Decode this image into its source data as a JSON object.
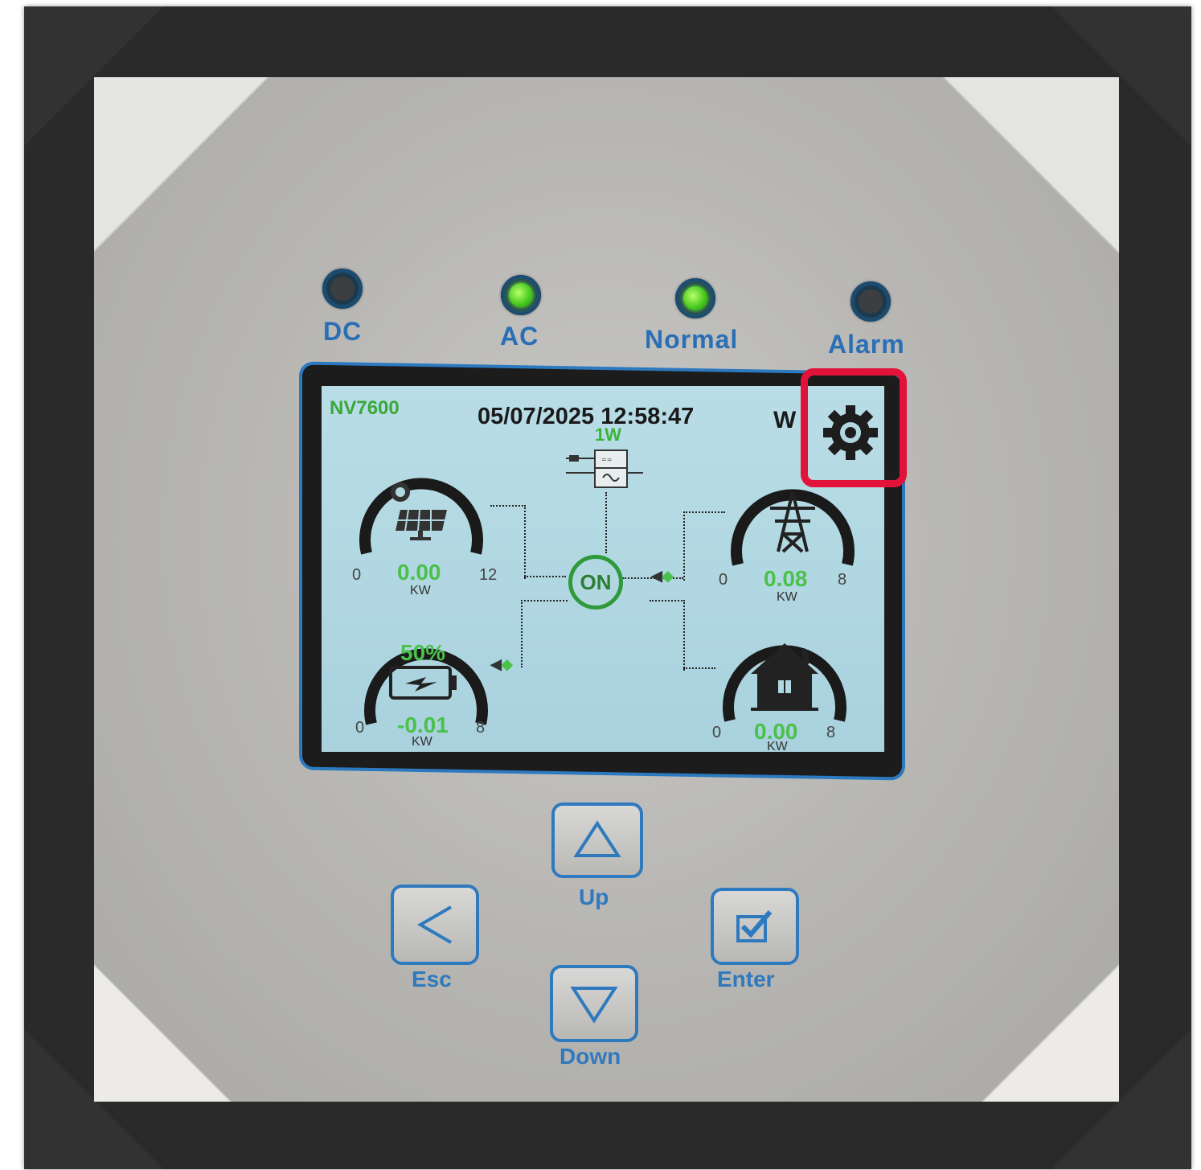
{
  "leds": [
    {
      "label": "DC",
      "state": "off"
    },
    {
      "label": "AC",
      "state": "on"
    },
    {
      "label": "Normal",
      "state": "on"
    },
    {
      "label": "Alarm",
      "state": "off"
    }
  ],
  "screen": {
    "model": "NV7600",
    "datetime": "05/07/2025 12:58:47",
    "mode_text": "W",
    "inverter_power": "1W",
    "status": "ON",
    "solar": {
      "min": "0",
      "max": "12",
      "value": "0.00",
      "unit": "KW"
    },
    "grid": {
      "min": "0",
      "max": "8",
      "value": "0.08",
      "unit": "KW"
    },
    "battery": {
      "min": "0",
      "max": "8",
      "value": "-0.01",
      "unit": "KW",
      "soc": "50%"
    },
    "load": {
      "min": "0",
      "max": "8",
      "value": "0.00",
      "unit": "KW"
    }
  },
  "keys": {
    "up": "Up",
    "down": "Down",
    "esc": "Esc",
    "enter": "Enter"
  },
  "colors": {
    "accent_blue": "#2f79bf",
    "value_green": "#4bc04b",
    "highlight_red": "#e2133a"
  }
}
